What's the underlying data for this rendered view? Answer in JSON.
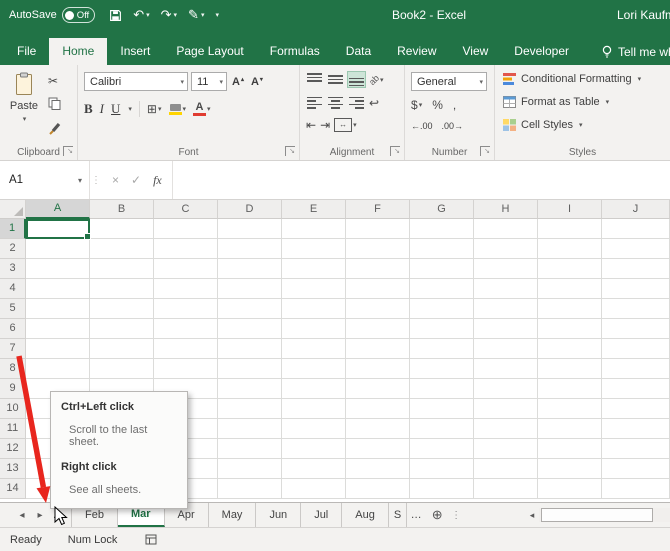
{
  "colors": {
    "excel_green": "#217346",
    "arrow_red": "#e8261e",
    "fill_yellow": "#ffd400",
    "font_color_red": "#e03c31"
  },
  "icons": {
    "dropdown": "▾",
    "up_triangle": "▴",
    "cut": "✂",
    "undo": "↶",
    "redo": "↷",
    "pen": "✎",
    "borders_grid": "⊞",
    "launcher_arrow": "↘",
    "left_nav": "◂",
    "right_nav": "▸",
    "ellipsis": "…",
    "new_sheet": "⊕",
    "wrap_return": "↩",
    "outdent": "⇤",
    "indent": "⇥",
    "merge_arrows": "↔",
    "dots_separator": "⋮"
  },
  "titlebar": {
    "autosave_label": "AutoSave",
    "autosave_state": "Off",
    "title": "Book2 - Excel",
    "user": "Lori Kaufman"
  },
  "ribbon_tabs": {
    "items": [
      "File",
      "Home",
      "Insert",
      "Page Layout",
      "Formulas",
      "Data",
      "Review",
      "View",
      "Developer"
    ],
    "active": "Home",
    "tell_me": "Tell me what you want to do"
  },
  "ribbon": {
    "clipboard": {
      "label": "Clipboard",
      "paste": "Paste"
    },
    "font": {
      "label": "Font",
      "name": "Calibri",
      "size": "11",
      "bold": "B",
      "italic": "I",
      "underline": "U",
      "grow": "A",
      "shrink": "A"
    },
    "alignment": {
      "label": "Alignment",
      "orientation": "ab"
    },
    "number": {
      "label": "Number",
      "format": "General",
      "currency": "$",
      "percent": "%",
      "comma": ",",
      "increase_decimal": "←.00",
      "decrease_decimal": ".00→"
    },
    "styles": {
      "label": "Styles",
      "items": [
        "Conditional Formatting",
        "Format as Table",
        "Cell Styles"
      ]
    }
  },
  "formula_bar": {
    "name_box": "A1",
    "cancel": "×",
    "enter": "✓",
    "fx": "fx",
    "value": ""
  },
  "grid": {
    "columns": [
      "A",
      "B",
      "C",
      "D",
      "E",
      "F",
      "G",
      "H",
      "I",
      "J"
    ],
    "rows": [
      "1",
      "2",
      "3",
      "4",
      "5",
      "6",
      "7",
      "8",
      "9",
      "10",
      "11",
      "12",
      "13",
      "14"
    ],
    "active_cell": "A1"
  },
  "tooltip": {
    "heading1": "Ctrl+Left click",
    "body1": "Scroll to the last sheet.",
    "heading2": "Right click",
    "body2": "See all sheets."
  },
  "sheets": {
    "tabs": [
      "Feb",
      "Mar",
      "Apr",
      "May",
      "Jun",
      "Jul",
      "Aug"
    ],
    "active": "Mar",
    "partial_tab": "S"
  },
  "status_bar": {
    "ready": "Ready",
    "num_lock": "Num Lock"
  }
}
